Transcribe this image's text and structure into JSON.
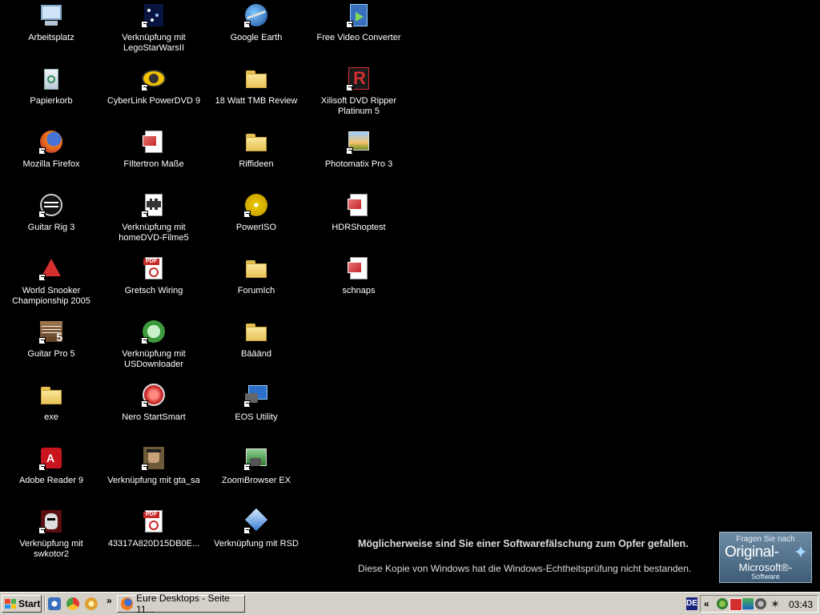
{
  "desktop": {
    "icons": [
      {
        "label": "Arbeitsplatz",
        "icon": "computer-icon",
        "shortcut": false
      },
      {
        "label": "Papierkorb",
        "icon": "recycle-bin-icon",
        "shortcut": false
      },
      {
        "label": "Mozilla Firefox",
        "icon": "firefox-icon",
        "shortcut": true
      },
      {
        "label": "Guitar Rig 3",
        "icon": "guitar-rig-icon",
        "shortcut": true
      },
      {
        "label": "World Snooker Championship 2005",
        "icon": "snooker-icon",
        "shortcut": true
      },
      {
        "label": "Guitar Pro 5",
        "icon": "guitar-pro-icon",
        "shortcut": true
      },
      {
        "label": "exe",
        "icon": "folder-icon",
        "shortcut": false
      },
      {
        "label": "Adobe Reader 9",
        "icon": "adobe-reader-icon",
        "shortcut": true
      },
      {
        "label": "Verknüpfung mit swkotor2",
        "icon": "kotor-icon",
        "shortcut": true
      },
      {
        "label": "Verknüpfung mit LegoStarWarsII",
        "icon": "lego-star-wars-icon",
        "shortcut": true
      },
      {
        "label": "CyberLink PowerDVD 9",
        "icon": "powerdvd-icon",
        "shortcut": true
      },
      {
        "label": "FIltertron Maße",
        "icon": "image-document-icon",
        "shortcut": false
      },
      {
        "label": "Verknüpfung mit homeDVD-Filme5",
        "icon": "film-document-icon",
        "shortcut": true
      },
      {
        "label": "Gretsch Wiring",
        "icon": "pdf-icon",
        "shortcut": false
      },
      {
        "label": "Verknüpfung mit USDownloader",
        "icon": "usdownloader-icon",
        "shortcut": true
      },
      {
        "label": "Nero StartSmart",
        "icon": "nero-icon",
        "shortcut": true
      },
      {
        "label": "Verknüpfung mit gta_sa",
        "icon": "gta-icon",
        "shortcut": true
      },
      {
        "label": "43317A820D15DB0E...",
        "icon": "pdf-icon",
        "shortcut": false
      },
      {
        "label": "Google Earth",
        "icon": "google-earth-icon",
        "shortcut": true
      },
      {
        "label": "18 Watt TMB Review",
        "icon": "folder-icon",
        "shortcut": false
      },
      {
        "label": "Riffideen",
        "icon": "folder-icon",
        "shortcut": false
      },
      {
        "label": "PowerISO",
        "icon": "poweriso-icon",
        "shortcut": true
      },
      {
        "label": "ForumIch",
        "icon": "folder-icon",
        "shortcut": false
      },
      {
        "label": "Bääänd",
        "icon": "folder-icon",
        "shortcut": false
      },
      {
        "label": "EOS Utility",
        "icon": "eos-utility-icon",
        "shortcut": true
      },
      {
        "label": "ZoomBrowser EX",
        "icon": "zoombrowser-icon",
        "shortcut": true
      },
      {
        "label": "Verknüpfung mit RSD",
        "icon": "rsd-icon",
        "shortcut": true
      },
      {
        "label": "Free Video Converter",
        "icon": "video-converter-icon",
        "shortcut": true
      },
      {
        "label": "Xilisoft DVD Ripper Platinum 5",
        "icon": "xilisoft-icon",
        "shortcut": true
      },
      {
        "label": "Photomatix Pro 3",
        "icon": "photomatix-icon",
        "shortcut": true
      },
      {
        "label": "HDRShoptest",
        "icon": "image-document-icon",
        "shortcut": false
      },
      {
        "label": "schnaps",
        "icon": "image-document-icon",
        "shortcut": false
      }
    ]
  },
  "wga_notice": {
    "title": "Möglicherweise sind Sie einer Softwarefälschung zum Opfer gefallen.",
    "text": "Diese Kopie von Windows hat die Windows-Echtheitsprüfung nicht bestanden.",
    "logo_line1": "Fragen Sie nach",
    "logo_line2": "Original-",
    "logo_line3": "Microsoft®-",
    "logo_line4": "Software"
  },
  "taskbar": {
    "start_label": "Start",
    "quicklaunch_more": "»",
    "task_firefox_label": "Eure Desktops - Seite 11...",
    "language": "DE",
    "tray_chevron": "«",
    "clock": "03:43"
  },
  "colors": {
    "desktop_bg": "#000000",
    "taskbar_bg": "#d4d0c8",
    "folder": "#f2d46b"
  }
}
